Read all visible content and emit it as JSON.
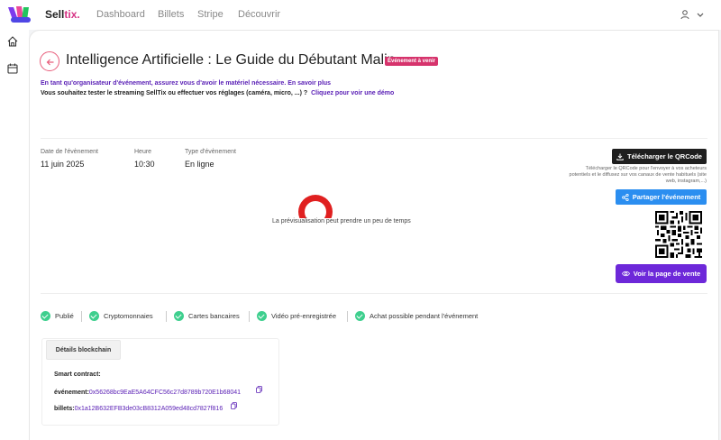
{
  "brand": {
    "name_part1": "Sell",
    "name_part2": "tix."
  },
  "nav": {
    "items": [
      "Dashboard",
      "Billets",
      "Stripe",
      "Découvrir"
    ]
  },
  "event": {
    "title": "Intelligence Artificielle : Le Guide du Débutant Malin",
    "badge": "Événement à venir",
    "info_line1": "En tant qu'organisateur d'événement, assurez vous d'avoir le matériel nécessaire. En savoir plus",
    "info_line2": "Vous souhaitez tester le streaming SellTix ou effectuer vos réglages (caméra, micro, ...) ?",
    "info_line2_link": "Cliquez pour voir une démo",
    "date_label": "Date de l'évènement",
    "date_value": "11 juin 2025",
    "time_label": "Heure",
    "time_value": "10:30",
    "type_label": "Type d'évènement",
    "type_value": "En ligne",
    "preview_text": "La prévisualisation peut prendre un peu de temps"
  },
  "actions": {
    "qr_button": "Télécharger le QRCode",
    "qr_description": "Télécharger le QRCode pour l'envoyer à vos acheteurs potentiels et le diffusez sur vos canaux de vente habituels (site web, instagram,...)",
    "share_button": "Partager l'événement",
    "sale_button": "Voir la page de vente"
  },
  "status_items": [
    "Publié",
    "Cryptomonnaies",
    "Cartes bancaires",
    "Vidéo pré-enregistrée",
    "Achat possible pendant l'événement"
  ],
  "blockchain": {
    "tab": "Détails blockchain",
    "smart_contract_label": "Smart contract:",
    "event_key": "événement:",
    "event_address": "0x56268bc9EaE5A64CFC56c27d8789b720E1b68041",
    "tickets_key": "billets:",
    "tickets_address": "0x1a12B632EFB3de03cB8312A059ed48cd7827f816"
  },
  "colors": {
    "accent_pink": "#d63384",
    "purple": "#6d28d9",
    "blue": "#2b8ef0",
    "green": "#3ecf8e"
  }
}
